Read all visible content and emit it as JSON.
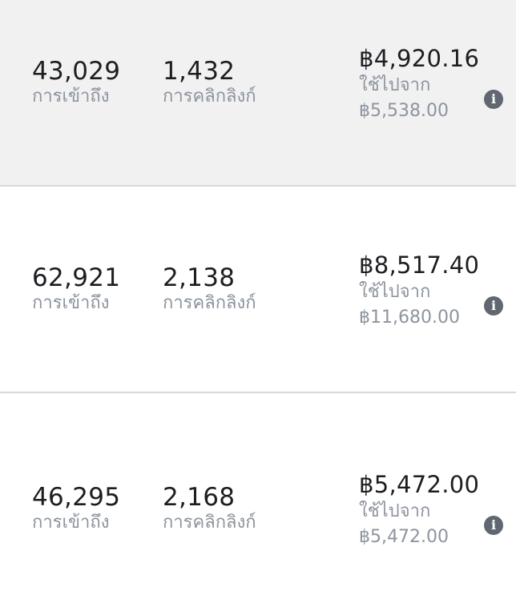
{
  "rows": [
    {
      "reach": "43,029",
      "reach_label": "การเข้าถึง",
      "clicks": "1,432",
      "clicks_label": "การคลิกลิงก์",
      "spent": "฿4,920.16",
      "spent_label": "ใช้ไปจาก",
      "budget": "฿5,538.00",
      "selected": true
    },
    {
      "reach": "62,921",
      "reach_label": "การเข้าถึง",
      "clicks": "2,138",
      "clicks_label": "การคลิกลิงก์",
      "spent": "฿8,517.40",
      "spent_label": "ใช้ไปจาก",
      "budget": "฿11,680.00",
      "selected": false
    },
    {
      "reach": "46,295",
      "reach_label": "การเข้าถึง",
      "clicks": "2,168",
      "clicks_label": "การคลิกลิงก์",
      "spent": "฿5,472.00",
      "spent_label": "ใช้ไปจาก",
      "budget": "฿5,472.00",
      "selected": false
    }
  ],
  "icons": {
    "info": "info-icon",
    "info_glyph": "i"
  },
  "colors": {
    "primary_text": "#1c1e21",
    "secondary_text": "#8d949e",
    "selected_row_bg": "#f1f1f1",
    "info_icon_bg": "#606770"
  }
}
